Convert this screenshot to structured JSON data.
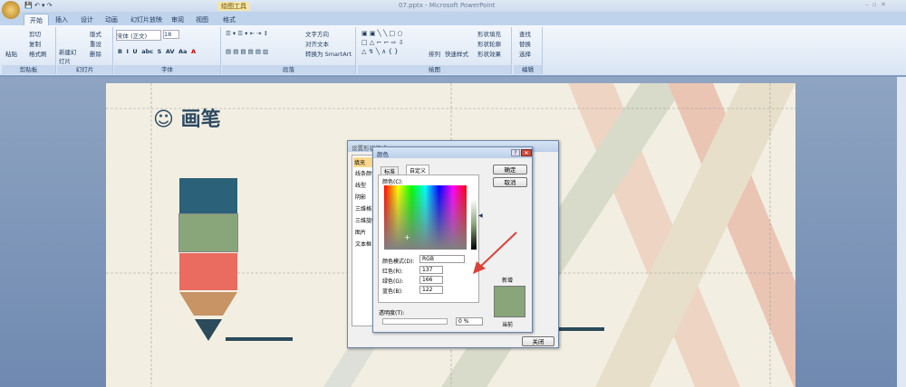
{
  "window": {
    "title": "07.pptx - Microsoft PowerPoint",
    "context_tool": "绘图工具"
  },
  "tabs": [
    "开始",
    "插入",
    "设计",
    "动画",
    "幻灯片放映",
    "审阅",
    "视图",
    "格式"
  ],
  "ribbon": {
    "clipboard": {
      "label": "剪贴板",
      "paste": "粘贴",
      "cut": "剪切",
      "copy": "复制",
      "format_painter": "格式刷"
    },
    "slides": {
      "label": "幻灯片",
      "new_slide": "新建幻灯片",
      "layout": "版式",
      "reset": "重设",
      "delete": "删除"
    },
    "font": {
      "label": "字体",
      "font_name": "宋体 (正文)",
      "font_size": "18"
    },
    "paragraph": {
      "label": "段落",
      "text_direction": "文字方向",
      "align_text": "对齐文本",
      "smartart": "转换为 SmartArt"
    },
    "drawing": {
      "label": "绘图",
      "arrange": "排列",
      "quick_styles": "快速样式",
      "shape_fill": "形状填充",
      "shape_outline": "形状轮廓",
      "shape_effects": "形状效果"
    },
    "editing": {
      "label": "编辑",
      "find": "查找",
      "replace": "替换",
      "select": "选择"
    }
  },
  "slide": {
    "title": "☺ 画笔"
  },
  "format_dialog": {
    "title": "设置形状格式",
    "nav": [
      "填充",
      "线条颜色",
      "线型",
      "阴影",
      "三维格式",
      "三维旋转",
      "图片",
      "文本框"
    ],
    "close": "关闭"
  },
  "color_dialog": {
    "title": "颜色",
    "tabs": [
      "标准",
      "自定义"
    ],
    "colors_label": "颜色(C):",
    "ok": "确定",
    "cancel": "取消",
    "color_model_label": "颜色模式(D):",
    "color_model": "RGB",
    "red_label": "红色(R):",
    "red": "137",
    "green_label": "绿色(G):",
    "green": "166",
    "blue_label": "蓝色(B):",
    "blue": "122",
    "transparency_label": "透明度(T):",
    "transparency": "0 %",
    "new_label": "新增",
    "current_label": "当前",
    "new_color": "#89a67a"
  }
}
